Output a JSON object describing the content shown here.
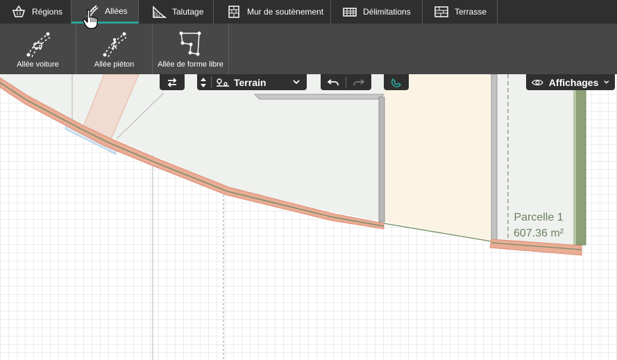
{
  "tabs": [
    {
      "id": "regions",
      "label": "Régions",
      "icon": "basket-icon",
      "active": false
    },
    {
      "id": "allees",
      "label": "Allées",
      "icon": "path-icon",
      "active": true
    },
    {
      "id": "talutage",
      "label": "Talutage",
      "icon": "slope-icon",
      "active": false
    },
    {
      "id": "mur",
      "label": "Mur de soutènement",
      "icon": "wall-icon",
      "active": false
    },
    {
      "id": "delimitations",
      "label": "Délimitations",
      "icon": "fence-icon",
      "active": false
    },
    {
      "id": "terrasse",
      "label": "Terrasse",
      "icon": "deck-icon",
      "active": false
    }
  ],
  "subtools": [
    {
      "id": "voiture",
      "label": "Allée voiture",
      "icon": "car-path-icon"
    },
    {
      "id": "pieton",
      "label": "Allée piéton",
      "icon": "pedestrian-path-icon"
    },
    {
      "id": "libre",
      "label": "Allée de forme libre",
      "icon": "freeform-path-icon"
    }
  ],
  "toolbar": {
    "layer_select": "Terrain",
    "view_label": "Affichages"
  },
  "parcel": {
    "name": "Parcelle 1",
    "area": "607.36 m²"
  },
  "colors": {
    "tabbar_bg": "#2f2f2f",
    "subbar_bg": "#474747",
    "active_accent": "#2aa39a",
    "path_fill": "#e7a890",
    "path_line": "#6f8a64",
    "house_fill": "#fbf4e4",
    "ground_fill": "#eef1ed",
    "hedge_green": "#8da078",
    "label_green": "#6b8060"
  }
}
